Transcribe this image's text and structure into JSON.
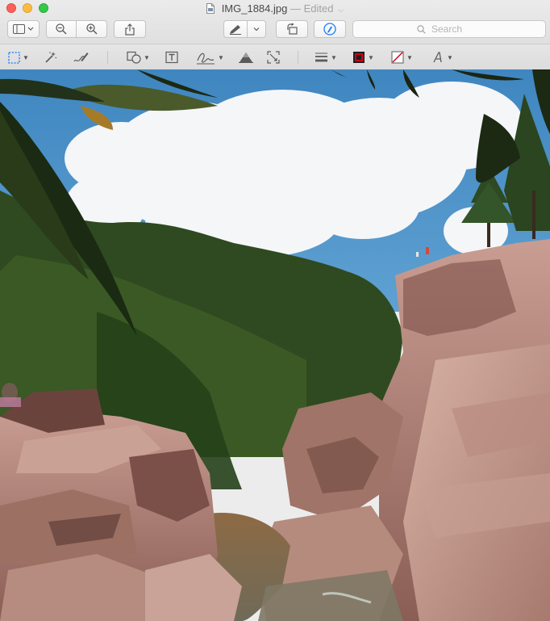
{
  "window": {
    "filename": "IMG_1884.jpg",
    "status": "— Edited"
  },
  "toolbar": {
    "search_placeholder": "Search"
  },
  "icons": {
    "close": "close-icon",
    "minimize": "minimize-icon",
    "zoom": "zoom-icon",
    "sidebar": "sidebar-icon",
    "zoom_out": "zoom-out-icon",
    "zoom_in": "zoom-in-icon",
    "share": "share-icon",
    "pen": "pen-icon",
    "rotate": "rotate-icon",
    "markup": "markup-icon",
    "search": "search-icon",
    "rect_select": "rectangular-selection-icon",
    "instant_alpha": "instant-alpha-icon",
    "sketch": "sketch-icon",
    "shapes": "shapes-icon",
    "text": "text-icon",
    "sign": "signature-icon",
    "adjust_color": "adjust-color-icon",
    "adjust_size": "adjust-size-icon",
    "shape_style": "shape-style-icon",
    "border_color": "border-color-icon",
    "fill_color": "fill-color-icon",
    "text_style": "text-style-icon"
  },
  "colors": {
    "border_color_swatch": "#d0021b",
    "fill_color_slash": "#d0021b",
    "markup_accent": "#1a7cf5"
  }
}
